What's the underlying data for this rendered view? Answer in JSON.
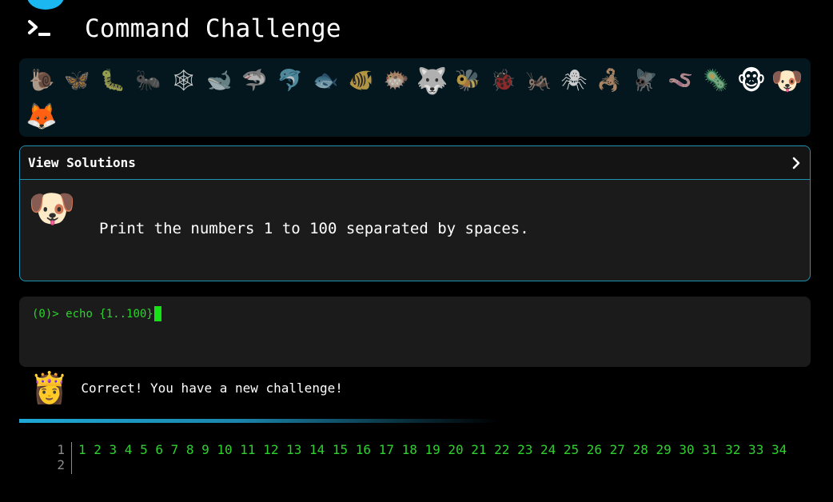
{
  "header": {
    "title": "Command Challenge",
    "icon": "terminal-prompt-icon",
    "accent": "#1bb7f0"
  },
  "level_bar": {
    "animals": [
      {
        "glyph": "🐌",
        "name": "snail"
      },
      {
        "glyph": "🦋",
        "name": "butterfly"
      },
      {
        "glyph": "🐛",
        "name": "caterpillar"
      },
      {
        "glyph": "🐜",
        "name": "ant"
      },
      {
        "glyph": "🕸",
        "name": "spider-web"
      },
      {
        "glyph": "🐋",
        "name": "whale"
      },
      {
        "glyph": "🦈",
        "name": "shark"
      },
      {
        "glyph": "🐬",
        "name": "dolphin"
      },
      {
        "glyph": "🐟",
        "name": "fish"
      },
      {
        "glyph": "🐠",
        "name": "tropical-fish"
      },
      {
        "glyph": "🐡",
        "name": "blowfish"
      },
      {
        "glyph": "🐺",
        "name": "wolf"
      },
      {
        "glyph": "🐝",
        "name": "bee"
      },
      {
        "glyph": "🐞",
        "name": "ladybug"
      },
      {
        "glyph": "🦗",
        "name": "cricket"
      },
      {
        "glyph": "🕷",
        "name": "spider"
      },
      {
        "glyph": "🦂",
        "name": "scorpion"
      },
      {
        "glyph": "🪰",
        "name": "fly"
      },
      {
        "glyph": "🪱",
        "name": "worm"
      },
      {
        "glyph": "🦠",
        "name": "microbe"
      },
      {
        "glyph": "🐵",
        "name": "monkey"
      },
      {
        "glyph": "🐶",
        "name": "dog"
      },
      {
        "glyph": "🦊",
        "name": "fox"
      }
    ]
  },
  "challenge": {
    "toggle_label": "View Solutions",
    "toggle_icon": "chevron-right-icon",
    "avatar": "🐶",
    "text": "Print the numbers 1 to 100 separated by spaces.",
    "border_color": "#1e93b4"
  },
  "command": {
    "prompt": "(0)>",
    "value": "echo {1..100}",
    "text_color": "#2fd12f"
  },
  "feedback": {
    "avatar": "👸",
    "message": "Correct! You have a new challenge!"
  },
  "output": {
    "line_numbers": [
      "1",
      "2"
    ],
    "lines": [
      "1 2 3 4 5 6 7 8 9 10 11 12 13 14 15 16 17 18 19 20 21 22 23 24 25 26 27 28 29 30 31 32 33 34",
      ""
    ]
  }
}
